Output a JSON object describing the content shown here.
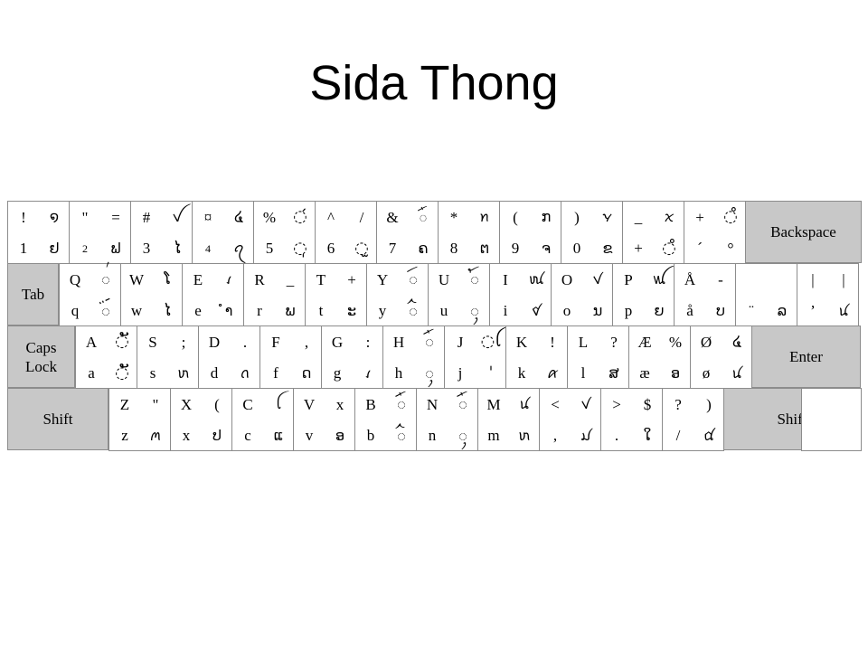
{
  "title": "Sida Thong",
  "keyboard": {
    "rows": [
      {
        "keys": [
          {
            "tl": "!",
            "bl": "1",
            "tr": "໑",
            "br": "ຢ"
          },
          {
            "tl": "\"",
            "bl": "2",
            "tr": "=",
            "br": "ຟ"
          },
          {
            "tl": "#",
            "bl": "3",
            "tr": "ꪜ",
            "br": "ໄ"
          },
          {
            "tl": "¤",
            "bl": "4",
            "tr": "໔",
            "br": "ꪖ"
          },
          {
            "tl": "%",
            "bl": "5",
            "tr": "◌́",
            "br": "◌̩"
          },
          {
            "tl": "^",
            "bl": "6",
            "tr": "/",
            "br": "◌̫"
          },
          {
            "tl": "&",
            "bl": "7",
            "tr": "ꪸ",
            "br": "ຄ"
          },
          {
            "tl": "*",
            "bl": "8",
            "tr": "ꪀ",
            "br": "ຕ"
          },
          {
            "tl": "(",
            "bl": "9",
            "tr": "ກ",
            "br": "ຈ"
          },
          {
            "tl": ")",
            "bl": "0",
            "tr": "ꪩ",
            "br": "ຂ"
          },
          {
            "tl": "_",
            "bl": "+",
            "tr": "ꪎ",
            "br": "◌̊"
          },
          {
            "tl": "+",
            "bl": "´",
            "tr": "◌̊",
            "br": "°"
          }
        ],
        "end": {
          "label": "Backspace"
        }
      },
      {
        "start": {
          "label": "Tab"
        },
        "keys": [
          {
            "tl": "Q",
            "bl": "q",
            "tr": "◌꪿",
            "br": "◌ꪾ"
          },
          {
            "tl": "W",
            "bl": "w",
            "tr": "ໂ",
            "br": "ໄ"
          },
          {
            "tl": "E",
            "bl": "e",
            "tr": "ꪹ",
            "br": "ຳ"
          },
          {
            "tl": "R",
            "bl": "r",
            "tr": "_",
            "br": "ພ"
          },
          {
            "tl": "T",
            "bl": "t",
            "tr": "+",
            "br": "ະ"
          },
          {
            "tl": "Y",
            "bl": "y",
            "tr": "◌ꪷ",
            "br": "◌ꪲ"
          },
          {
            "tl": "U",
            "bl": "u",
            "tr": "◌ꪳ",
            "br": "◌ꪴ"
          },
          {
            "tl": "I",
            "bl": "i",
            "tr": "ꪘ",
            "br": "ꪥ"
          },
          {
            "tl": "O",
            "bl": "o",
            "tr": "ꪚ",
            "br": "ນ"
          },
          {
            "tl": "P",
            "bl": "p",
            "tr": "ꪡ",
            "br": "ຍ"
          },
          {
            "tl": "Å",
            "bl": "å",
            "tr": "-",
            "br": "ບ"
          },
          {
            "tl": "",
            "bl": "¨",
            "tr": "",
            "br": "ລ"
          },
          {
            "tl": "|",
            "bl": "’",
            "tr": "|",
            "br": "ꪙ"
          }
        ]
      },
      {
        "start": {
          "label": "Caps\nLock"
        },
        "keys": [
          {
            "tl": "A",
            "bl": "a",
            "tr": "◌ັ",
            "br": "◌ັ"
          },
          {
            "tl": "S",
            "bl": "s",
            "tr": ";",
            "br": "ꪬ"
          },
          {
            "tl": "D",
            "bl": "d",
            "tr": ".",
            "br": "ꪒ"
          },
          {
            "tl": "F",
            "bl": "f",
            "tr": ",",
            "br": "ດ"
          },
          {
            "tl": "G",
            "bl": "g",
            "tr": ":",
            "br": "ꪹ"
          },
          {
            "tl": "H",
            "bl": "h",
            "tr": "◌ꪸ",
            "br": "◌ꪴ"
          },
          {
            "tl": "J",
            "bl": "j",
            "tr": "◌ꪶ",
            "br": "ˈ"
          },
          {
            "tl": "K",
            "bl": "k",
            "tr": "!",
            "br": "ꪁ"
          },
          {
            "tl": "L",
            "bl": "l",
            "tr": "?",
            "br": "ສ"
          },
          {
            "tl": "Æ",
            "bl": "æ",
            "tr": "%",
            "br": "ອ"
          },
          {
            "tl": "Ø",
            "bl": "ø",
            "tr": "໔",
            "br": "ꪙ"
          }
        ],
        "end": {
          "label": "Enter"
        }
      },
      {
        "start": {
          "label": "Shift"
        },
        "keys": [
          {
            "tl": "Z",
            "bl": "z",
            "tr": "\"",
            "br": "ꪔ"
          },
          {
            "tl": "X",
            "bl": "x",
            "tr": "(",
            "br": "ປ"
          },
          {
            "tl": "C",
            "bl": "c",
            "tr": "ꪶ",
            "br": "ແ"
          },
          {
            "tl": "V",
            "bl": "v",
            "tr": "x",
            "br": "ອ"
          },
          {
            "tl": "B",
            "bl": "b",
            "tr": "◌ꪸ",
            "br": "◌ꪲ"
          },
          {
            "tl": "N",
            "bl": "n",
            "tr": "◌ꪸ",
            "br": "◌ꪴ"
          },
          {
            "tl": "M",
            "bl": "m",
            "tr": "ꪙ",
            "br": "ꪬ"
          },
          {
            "tl": "<",
            "bl": ",",
            "tr": "ꪚ",
            "br": "ꪣ"
          },
          {
            "tl": ">",
            "bl": ".",
            "tr": "$",
            "br": "ໃ"
          },
          {
            "tl": "?",
            "bl": "/",
            "tr": ")",
            "br": "ꪠ"
          }
        ],
        "end": {
          "label": "Shift"
        }
      }
    ]
  }
}
